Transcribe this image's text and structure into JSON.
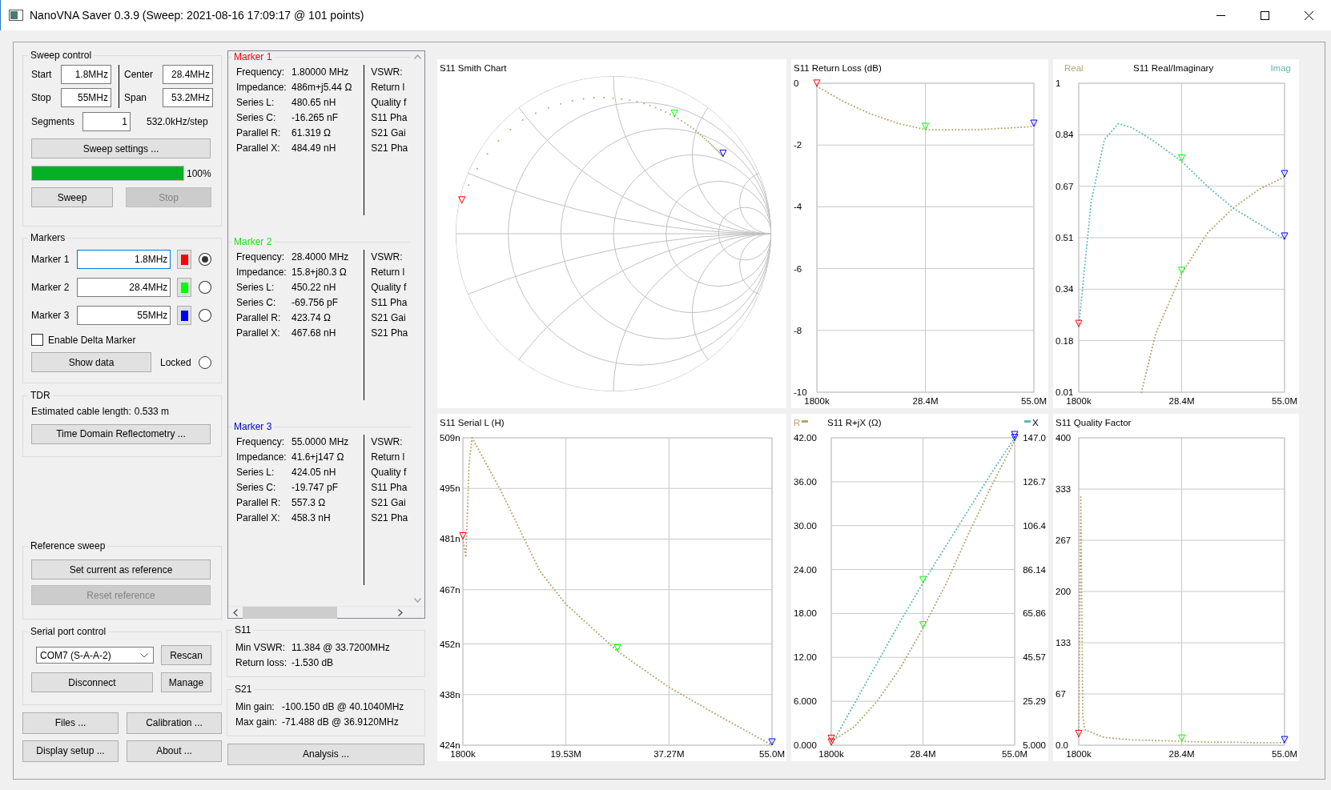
{
  "window": {
    "title": "NanoVNA Saver 0.3.9 (Sweep: 2021-08-16 17:09:17 @ 101 points)"
  },
  "sweep_control": {
    "title": "Sweep control",
    "fields": [
      {
        "label": "Start",
        "value": "1.8MHz"
      },
      {
        "label": "Center",
        "value": "28.4MHz"
      },
      {
        "label": "Stop",
        "value": "55MHz"
      },
      {
        "label": "Span",
        "value": "53.2MHz"
      }
    ],
    "segments": {
      "label": "Segments",
      "value": "1"
    },
    "step": "532.0kHz/step",
    "settings_button": "Sweep settings ...",
    "progress": {
      "level": 1,
      "reading": "100%"
    },
    "buttons": [
      {
        "label": "Sweep",
        "disabled": false
      },
      {
        "label": "Stop",
        "disabled": true
      }
    ]
  },
  "markers": {
    "title": "Markers",
    "items": [
      {
        "label": "Marker 1",
        "value": "1.8MHz",
        "color": "#ff0000",
        "focused": true,
        "selected": true
      },
      {
        "label": "Marker 2",
        "value": "28.4MHz",
        "color": "#00ff00",
        "focused": false,
        "selected": false
      },
      {
        "label": "Marker 3",
        "value": "55MHz",
        "color": "#0000ff",
        "focused": false,
        "selected": false
      }
    ],
    "delta": {
      "label": "Enable Delta Marker",
      "checked": false
    },
    "show_data_button": "Show data",
    "locked": {
      "label": "Locked",
      "selected": false
    }
  },
  "tdr": {
    "title": "TDR",
    "label": "Estimated cable length:",
    "value": "0.533 m",
    "button": "Time Domain Reflectometry ..."
  },
  "reference_sweep": {
    "title": "Reference sweep",
    "buttons": [
      {
        "label": "Set current as reference",
        "disabled": false
      },
      {
        "label": "Reset reference",
        "disabled": true
      }
    ]
  },
  "serial_port": {
    "title": "Serial port control",
    "port": "COM7 (S-A-A-2)",
    "buttons": [
      "Rescan",
      "Disconnect",
      "Manage"
    ]
  },
  "footer_buttons": [
    "Files ...",
    "Calibration ...",
    "Display setup ...",
    "About ..."
  ],
  "marker_details": [
    {
      "title": "Marker 1",
      "color": "#ff0000",
      "rows": [
        {
          "label": "Frequency:",
          "value": "1.80000 MHz"
        },
        {
          "label": "Impedance:",
          "value": "486m+j5.44 Ω"
        },
        {
          "label": "Series L:",
          "value": "480.65 nH"
        },
        {
          "label": "Series C:",
          "value": "-16.265 nF"
        },
        {
          "label": "Parallel R:",
          "value": "61.319 Ω"
        },
        {
          "label": "Parallel X:",
          "value": "484.49 nH"
        }
      ],
      "more_labels": [
        "VSWR:",
        "Return l",
        "Quality f",
        "S11 Pha",
        "S21 Gai",
        "S21 Pha"
      ]
    },
    {
      "title": "Marker 2",
      "color": "#22dd22",
      "rows": [
        {
          "label": "Frequency:",
          "value": "28.4000 MHz"
        },
        {
          "label": "Impedance:",
          "value": "15.8+j80.3 Ω"
        },
        {
          "label": "Series L:",
          "value": "450.22 nH"
        },
        {
          "label": "Series C:",
          "value": "-69.756 pF"
        },
        {
          "label": "Parallel R:",
          "value": "423.74 Ω"
        },
        {
          "label": "Parallel X:",
          "value": "467.68 nH"
        }
      ],
      "more_labels": [
        "VSWR:",
        "Return l",
        "Quality f",
        "S11 Pha",
        "S21 Gai",
        "S21 Pha"
      ]
    },
    {
      "title": "Marker 3",
      "color": "#0000cc",
      "rows": [
        {
          "label": "Frequency:",
          "value": "55.0000 MHz"
        },
        {
          "label": "Impedance:",
          "value": "41.6+j147 Ω"
        },
        {
          "label": "Series L:",
          "value": "424.05 nH"
        },
        {
          "label": "Series C:",
          "value": "-19.747 pF"
        },
        {
          "label": "Parallel R:",
          "value": "557.3 Ω"
        },
        {
          "label": "Parallel X:",
          "value": "458.3 nH"
        }
      ],
      "more_labels": [
        "VSWR:",
        "Return l",
        "Quality f",
        "S11 Pha",
        "S21 Gai",
        "S21 Pha"
      ]
    }
  ],
  "s11": {
    "title": "S11",
    "rows": [
      {
        "label": "Min VSWR:",
        "value": "11.384 @ 33.7200MHz"
      },
      {
        "label": "Return loss:",
        "value": "-1.530 dB"
      }
    ]
  },
  "s21": {
    "title": "S21",
    "rows": [
      {
        "label": "Min gain:",
        "value": "-100.150 dB @ 40.1040MHz"
      },
      {
        "label": "Max gain:",
        "value": "-71.488 dB @ 36.9120MHz"
      }
    ]
  },
  "analysis_button": "Analysis ...",
  "charts": [
    {
      "kind": "smith",
      "title": "S11 Smith Chart"
    },
    {
      "kind": "xy",
      "chart_data": {
        "type": "line",
        "title": "S11 Return Loss (dB)",
        "x": [
          1800000,
          8450000,
          15100000,
          21750000,
          28400000,
          35050000,
          41700000,
          48350000,
          55000000
        ],
        "values": [
          -0.1,
          -0.6,
          -1.0,
          -1.3,
          -1.5,
          -1.5,
          -1.5,
          -1.45,
          -1.4
        ],
        "line_style": "dotted",
        "grid": true,
        "xlim": [
          1800000,
          55000000
        ],
        "ylim": [
          -10,
          0
        ],
        "xticks": [
          {
            "value": 1800000,
            "label": "1800k"
          },
          {
            "value": 28400000,
            "label": "28.4M"
          },
          {
            "value": 55000000,
            "label": "55.0M"
          }
        ],
        "yticks": [
          0,
          -2,
          -4,
          -6,
          -8,
          -10
        ]
      }
    },
    {
      "kind": "xy",
      "chart_data": {
        "type": "line",
        "title": "S11 Real/Imaginary",
        "x": [
          1800000,
          5000000,
          8450000,
          12000000,
          15100000,
          18000000,
          21750000,
          28400000,
          35050000,
          41700000,
          48350000,
          55000000
        ],
        "series": [
          {
            "name": "Real",
            "color": "#b5a56e",
            "line_style": "dotted",
            "values": [
              null,
              null,
              null,
              null,
              null,
              0.01,
              0.2,
              0.39,
              0.52,
              0.6,
              0.66,
              0.7
            ]
          },
          {
            "name": "Imag",
            "color": "#5cbcb4",
            "line_style": "dotted",
            "values": [
              0.22,
              0.62,
              0.82,
              0.87,
              0.86,
              0.84,
              0.81,
              0.75,
              0.67,
              0.6,
              0.55,
              0.5
            ]
          }
        ],
        "grid": true,
        "xlim": [
          1800000,
          55000000
        ],
        "ylim": [
          0.01,
          1
        ],
        "xticks": [
          {
            "value": 1800000,
            "label": "1800k"
          },
          {
            "value": 28400000,
            "label": "28.4M"
          },
          {
            "value": 55000000,
            "label": "55.0M"
          }
        ],
        "yticks": [
          {
            "value": 0.01,
            "label": "0.01"
          },
          {
            "value": 0.175,
            "label": "0.18"
          },
          {
            "value": 0.34,
            "label": "0.34"
          },
          {
            "value": 0.505,
            "label": "0.51"
          },
          {
            "value": 0.67,
            "label": "0.67"
          },
          {
            "value": 0.835,
            "label": "0.84"
          },
          {
            "value": 1,
            "label": "1"
          }
        ]
      }
    },
    {
      "kind": "xy",
      "chart_data": {
        "type": "line",
        "title": "S11 Serial L (H)",
        "x": [
          1800000,
          2330000,
          2860000,
          3400000,
          8450000,
          15100000,
          19530000,
          28400000,
          37270000,
          46000000,
          55000000
        ],
        "values": [
          481,
          476,
          502,
          509,
          494,
          472,
          463,
          450,
          440,
          432,
          424
        ],
        "line_style": "dotted",
        "grid": true,
        "xlim": [
          1800000,
          55000000
        ],
        "ylim": [
          424,
          509
        ],
        "xticks": [
          {
            "value": 1800000,
            "label": "1800k"
          },
          {
            "value": 19530000,
            "label": "19.53M"
          },
          {
            "value": 37270000,
            "label": "37.27M"
          },
          {
            "value": 55000000,
            "label": "55.0M"
          }
        ],
        "yticks": [
          {
            "value": 424,
            "label": "424n"
          },
          {
            "value": 438,
            "label": "438n"
          },
          {
            "value": 452,
            "label": "452n"
          },
          {
            "value": 467,
            "label": "467n"
          },
          {
            "value": 481,
            "label": "481n"
          },
          {
            "value": 495,
            "label": "495n"
          },
          {
            "value": 509,
            "label": "509n"
          }
        ]
      }
    },
    {
      "kind": "xy",
      "chart_data": {
        "type": "line",
        "title": "S11 R+jX (Ω)",
        "x": [
          1800000,
          8450000,
          15100000,
          21750000,
          28400000,
          35050000,
          41700000,
          48350000,
          55000000
        ],
        "series": [
          {
            "name": "R",
            "color": "#b5a56e",
            "line_style": "dotted",
            "values": [
              0.5,
              2.5,
              6,
              10.5,
              16,
              22,
              29,
              35.5,
              41.6
            ]
          },
          {
            "name": "X",
            "color": "#5cbcb4",
            "line_style": "dotted",
            "axis": "y2",
            "values": [
              5,
              24,
              43,
              62,
              80,
              97,
              114,
              131,
              147
            ]
          }
        ],
        "grid": true,
        "xlim": [
          1800000,
          55000000
        ],
        "ylim": [
          0,
          42
        ],
        "y2lim": [
          5,
          147
        ],
        "xticks": [
          {
            "value": 1800000,
            "label": "1800k"
          },
          {
            "value": 28400000,
            "label": "28.4M"
          },
          {
            "value": 55000000,
            "label": "55.0M"
          }
        ],
        "yticks": [
          {
            "value": 0,
            "label": "0.000"
          },
          {
            "value": 6,
            "label": "6.000"
          },
          {
            "value": 12,
            "label": "12.00"
          },
          {
            "value": 18,
            "label": "18.00"
          },
          {
            "value": 24,
            "label": "24.00"
          },
          {
            "value": 30,
            "label": "30.00"
          },
          {
            "value": 36,
            "label": "36.00"
          },
          {
            "value": 42,
            "label": "42.00"
          }
        ],
        "y2ticks": [
          {
            "value": 5,
            "label": "5.000"
          },
          {
            "value": 25.29,
            "label": "25.29"
          },
          {
            "value": 45.57,
            "label": "45.57"
          },
          {
            "value": 65.86,
            "label": "65.86"
          },
          {
            "value": 86.14,
            "label": "86.14"
          },
          {
            "value": 106.4,
            "label": "106.4"
          },
          {
            "value": 126.7,
            "label": "126.7"
          },
          {
            "value": 147,
            "label": "147.0"
          }
        ]
      }
    },
    {
      "kind": "xy",
      "chart_data": {
        "type": "line",
        "title": "S11 Quality Factor",
        "x": [
          1800000,
          2330000,
          2860000,
          3400000,
          8450000,
          15100000,
          21750000,
          28400000,
          35050000,
          41700000,
          48350000,
          55000000
        ],
        "values": [
          11,
          325,
          38,
          20,
          10,
          7,
          6,
          5,
          4,
          4,
          3,
          3
        ],
        "line_style": "dotted",
        "grid": true,
        "xlim": [
          1800000,
          55000000
        ],
        "ylim": [
          0,
          400
        ],
        "xticks": [
          {
            "value": 1800000,
            "label": "1800k"
          },
          {
            "value": 28400000,
            "label": "28.4M"
          },
          {
            "value": 55000000,
            "label": "55.0M"
          }
        ],
        "yticks": [
          {
            "value": 0,
            "label": "0.0"
          },
          {
            "value": 66.67,
            "label": "67"
          },
          {
            "value": 133.33,
            "label": "133"
          },
          {
            "value": 200,
            "label": "200"
          },
          {
            "value": 266.67,
            "label": "267"
          },
          {
            "value": 333.33,
            "label": "333"
          },
          {
            "value": 400,
            "label": "400"
          }
        ]
      }
    }
  ]
}
